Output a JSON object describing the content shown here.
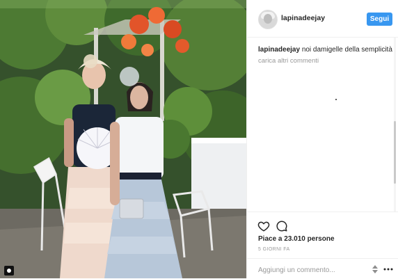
{
  "post": {
    "username": "lapinadeejay",
    "follow_label": "Segui",
    "caption_user": "lapinadeejay",
    "caption_text": "noi damigelle della semplicità",
    "load_more": "carica altri commenti",
    "likes": "Piace a 23.010 persone",
    "timestamp": "5 GIORNI FA",
    "comment_placeholder": "Aggiungi un commento..."
  },
  "icons": {
    "like": "heart-icon",
    "comment": "comment-icon",
    "sort": "sort-arrows-icon",
    "more": "more-options-icon",
    "user_tag": "user-tag-icon"
  },
  "colors": {
    "follow_button": "#3897f0",
    "muted_text": "#999999",
    "divider": "#efefef"
  }
}
